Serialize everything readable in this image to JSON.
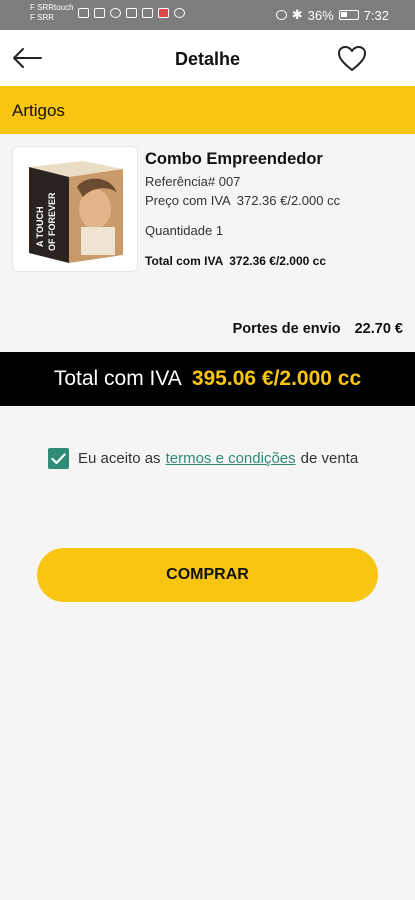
{
  "status_bar": {
    "carrier_1": "F SRRtouch",
    "carrier_2": "F SRR",
    "battery": "36%",
    "time": "7:32"
  },
  "header": {
    "title": "Detalhe",
    "back_icon": "arrow-left-icon",
    "favorite_icon": "heart-outline-icon"
  },
  "section": {
    "title": "Artigos"
  },
  "product": {
    "name": "Combo Empreendedor",
    "reference": "Referência# 007",
    "price_label": "Preço com IVA",
    "price_value": "372.36 €/2.000 cc",
    "quantity": "Quantidade 1",
    "total_label": "Total com IVA",
    "total_value": "372.36 €/2.000 cc",
    "image_text_1": "A TOUCH",
    "image_text_2": "OF FOREVER"
  },
  "shipping": {
    "label": "Portes de envio",
    "value": "22.70 €"
  },
  "total": {
    "label": "Total com IVA",
    "value": "395.06 €/2.000 cc"
  },
  "terms": {
    "checked": true,
    "prefix": "Eu aceito as",
    "link": "termos e condições",
    "suffix": "de venta"
  },
  "buy_button": {
    "label": "COMPRAR"
  },
  "colors": {
    "accent": "#f9c513",
    "link": "#2f8b76",
    "total_bar": "#000000"
  }
}
